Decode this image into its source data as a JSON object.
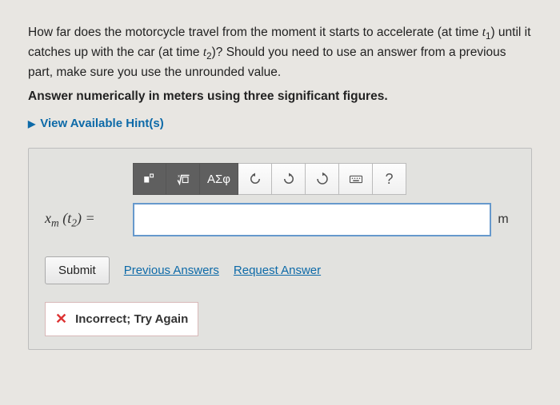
{
  "question": {
    "text_html": "How far does the motorcycle travel from the moment it starts to accelerate (at time <span class='italic'>t</span><sub>1</sub>) until it catches up with the car (at time <span class='italic'>t</span><sub>2</sub>)? Should you need to use an answer from a previous part, make sure you use the unrounded value.",
    "instruction": "Answer numerically in meters using three significant figures."
  },
  "hints": {
    "label": "View Available Hint(s)"
  },
  "toolbar": {
    "template": "template-icon",
    "radical": "radical-icon",
    "greek": "ΑΣφ",
    "undo": "undo-icon",
    "redo": "redo-icon",
    "reset": "reset-icon",
    "keyboard": "keyboard-icon",
    "help": "?"
  },
  "input": {
    "var_label_html": "<span class='italic'>x</span><sub>m</sub> (<span class='italic'>t</span><sub>2</sub>) =",
    "value": "",
    "unit": "m"
  },
  "buttons": {
    "submit": "Submit",
    "previous": "Previous Answers",
    "request": "Request Answer"
  },
  "feedback": {
    "text": "Incorrect; Try Again"
  }
}
